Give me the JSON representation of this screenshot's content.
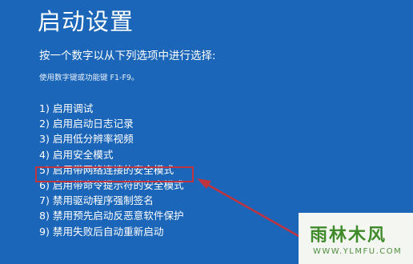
{
  "title": "启动设置",
  "prompt": "按一个数字以从下列选项中进行选择:",
  "hint": "使用数字键或功能键 F1-F9。",
  "options": [
    "1) 启用调试",
    "2) 启用启动日志记录",
    "3) 启用低分辨率视频",
    "4) 启用安全模式",
    "5) 启用带网络连接的安全模式",
    "6) 启用带命令提示符的安全模式",
    "7) 禁用驱动程序强制签名",
    "8) 禁用预先启动反恶意软件保护",
    "9) 禁用失败后自动重新启动"
  ],
  "highlighted_option_index": 4,
  "watermark": {
    "name": "雨林木风",
    "url": "WWW.YLMFU.COM"
  },
  "colors": {
    "background": "#1b66b8",
    "text": "#ffffff",
    "highlight_annotation": "#c0343f",
    "watermark_text": "#3f8a2a"
  }
}
